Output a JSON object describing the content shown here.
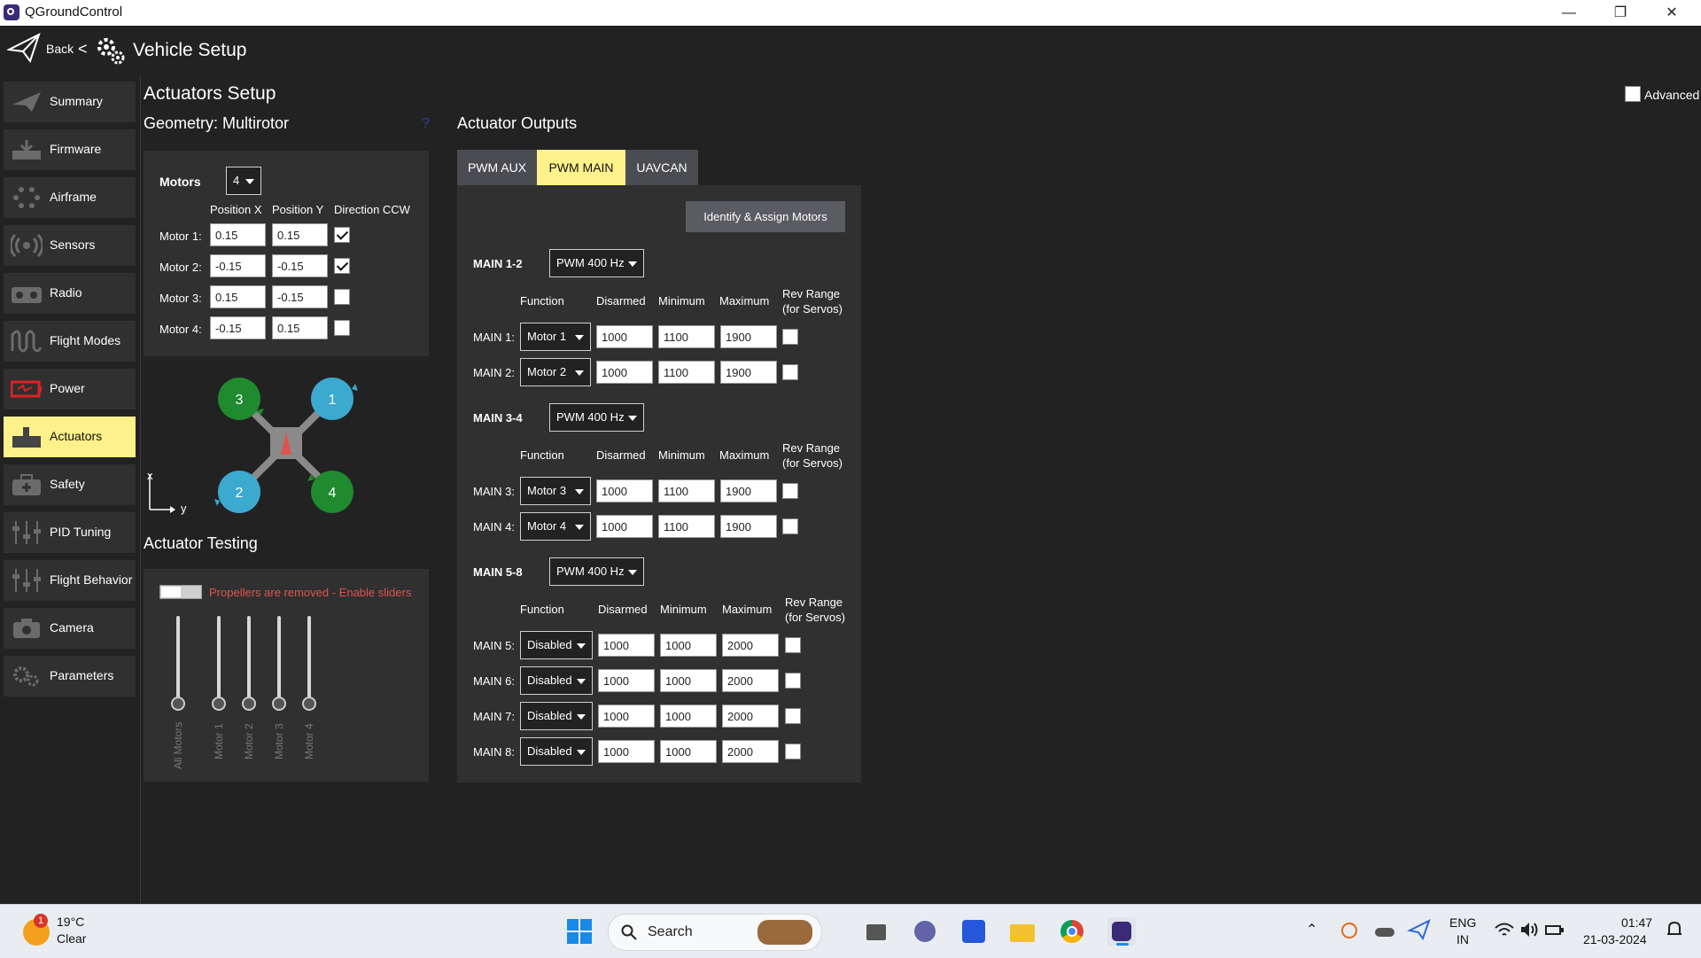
{
  "window": {
    "title": "QGroundControl"
  },
  "header": {
    "back_label": "Back",
    "separator": "<",
    "title": "Vehicle Setup"
  },
  "sidebar": {
    "items": [
      {
        "label": "Summary",
        "icon": "paper-plane-icon"
      },
      {
        "label": "Firmware",
        "icon": "firmware-icon"
      },
      {
        "label": "Airframe",
        "icon": "airframe-icon"
      },
      {
        "label": "Sensors",
        "icon": "sensors-icon"
      },
      {
        "label": "Radio",
        "icon": "radio-icon"
      },
      {
        "label": "Flight Modes",
        "icon": "flight-modes-icon"
      },
      {
        "label": "Power",
        "icon": "battery-icon"
      },
      {
        "label": "Actuators",
        "icon": "actuators-icon",
        "active": true
      },
      {
        "label": "Safety",
        "icon": "safety-icon"
      },
      {
        "label": "PID Tuning",
        "icon": "sliders-icon"
      },
      {
        "label": "Flight Behavior",
        "icon": "sliders-icon"
      },
      {
        "label": "Camera",
        "icon": "camera-icon"
      },
      {
        "label": "Parameters",
        "icon": "parameters-icon"
      }
    ]
  },
  "main": {
    "title": "Actuators Setup",
    "advanced_label": "Advanced",
    "geometry": {
      "title": "Geometry: Multirotor",
      "help": "?",
      "motors_label": "Motors",
      "motors_value": "4",
      "headers": [
        "Position X",
        "Position Y",
        "Direction CCW"
      ],
      "rows": [
        {
          "label": "Motor 1:",
          "x": "0.15",
          "y": "0.15",
          "ccw": true
        },
        {
          "label": "Motor 2:",
          "x": "-0.15",
          "y": "-0.15",
          "ccw": true
        },
        {
          "label": "Motor 3:",
          "x": "0.15",
          "y": "-0.15",
          "ccw": false
        },
        {
          "label": "Motor 4:",
          "x": "-0.15",
          "y": "0.15",
          "ccw": false
        }
      ],
      "diagram": {
        "motor_numbers": [
          "3",
          "1",
          "2",
          "4"
        ],
        "axis_x": "x",
        "axis_y": "y"
      }
    },
    "testing": {
      "title": "Actuator Testing",
      "warning": "Propellers are removed - Enable sliders",
      "sliders": [
        "All Motors",
        "Motor 1",
        "Motor 2",
        "Motor 3",
        "Motor 4"
      ]
    },
    "outputs": {
      "title": "Actuator Outputs",
      "tabs": [
        "PWM AUX",
        "PWM MAIN",
        "UAVCAN"
      ],
      "active_tab": "PWM MAIN",
      "identify_button": "Identify & Assign Motors",
      "column_headers": {
        "function": "Function",
        "disarmed": "Disarmed",
        "minimum": "Minimum",
        "maximum": "Maximum",
        "rev_range_1": "Rev Range",
        "rev_range_2": "(for Servos)"
      },
      "groups": [
        {
          "label": "MAIN 1-2",
          "rate": "PWM 400 Hz",
          "rows": [
            {
              "label": "MAIN 1:",
              "function": "Motor 1",
              "disarmed": "1000",
              "min": "1100",
              "max": "1900"
            },
            {
              "label": "MAIN 2:",
              "function": "Motor 2",
              "disarmed": "1000",
              "min": "1100",
              "max": "1900"
            }
          ]
        },
        {
          "label": "MAIN 3-4",
          "rate": "PWM 400 Hz",
          "rows": [
            {
              "label": "MAIN 3:",
              "function": "Motor 3",
              "disarmed": "1000",
              "min": "1100",
              "max": "1900"
            },
            {
              "label": "MAIN 4:",
              "function": "Motor 4",
              "disarmed": "1000",
              "min": "1100",
              "max": "1900"
            }
          ]
        },
        {
          "label": "MAIN 5-8",
          "rate": "PWM 400 Hz",
          "rows": [
            {
              "label": "MAIN 5:",
              "function": "Disabled",
              "disarmed": "1000",
              "min": "1000",
              "max": "2000"
            },
            {
              "label": "MAIN 6:",
              "function": "Disabled",
              "disarmed": "1000",
              "min": "1000",
              "max": "2000"
            },
            {
              "label": "MAIN 7:",
              "function": "Disabled",
              "disarmed": "1000",
              "min": "1000",
              "max": "2000"
            },
            {
              "label": "MAIN 8:",
              "function": "Disabled",
              "disarmed": "1000",
              "min": "1000",
              "max": "2000"
            }
          ]
        }
      ]
    }
  },
  "taskbar": {
    "weather_temp": "19°C",
    "weather_desc": "Clear",
    "weather_badge": "1",
    "search_label": "Search",
    "lang_1": "ENG",
    "lang_2": "IN",
    "time": "01:47",
    "date": "21-03-2024"
  },
  "colors": {
    "accent": "#fdf18b",
    "panel": "#303030",
    "background": "#222222",
    "warning": "#e0534f",
    "motor_ccw": "#1f8a2e",
    "motor_cw": "#3ca9cf"
  }
}
